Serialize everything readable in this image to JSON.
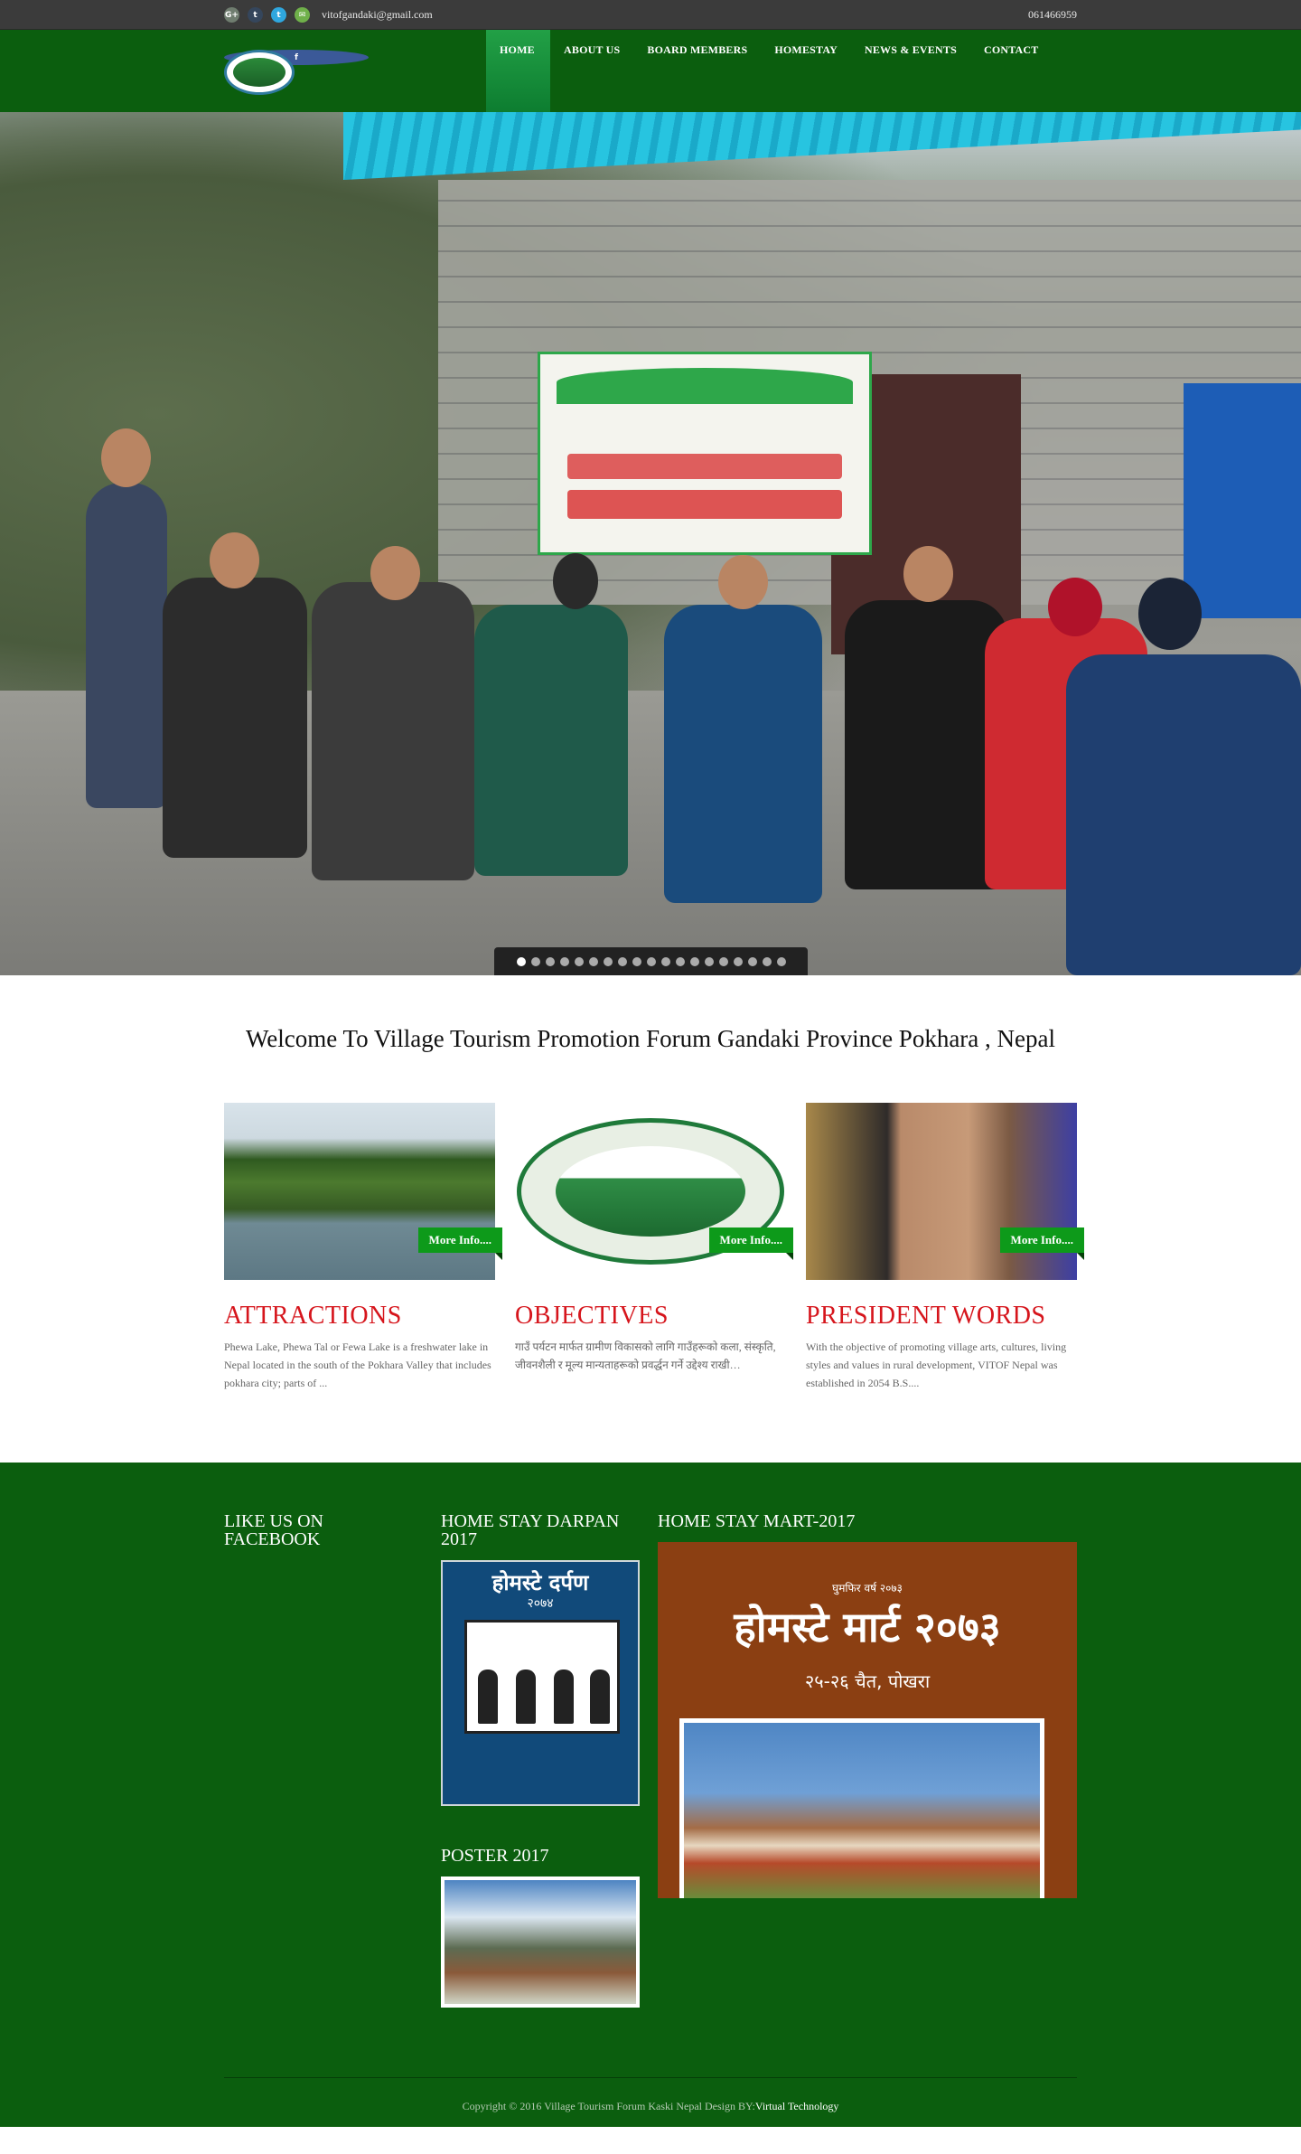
{
  "topbar": {
    "social": [
      {
        "icon": "google-plus-icon",
        "glyph": "G+"
      },
      {
        "icon": "facebook-icon",
        "glyph": "f"
      },
      {
        "icon": "tumblr-icon",
        "glyph": "t"
      },
      {
        "icon": "twitter-icon",
        "glyph": "t"
      },
      {
        "icon": "email-icon",
        "glyph": "✉"
      }
    ],
    "email": "vitofgandaki@gmail.com",
    "phone": "061466959"
  },
  "nav": {
    "items": [
      "HOME",
      "ABOUT US",
      "BOARD MEMBERS",
      "HOMESTAY",
      "NEWS & EVENTS",
      "CONTACT"
    ],
    "active": "HOME"
  },
  "hero": {
    "slide_count": 19,
    "active_slide": 1
  },
  "welcome": {
    "title": "Welcome To Village Tourism Promotion Forum Gandaki Province Pokhara , Nepal"
  },
  "features": [
    {
      "title": "ATTRACTIONS",
      "text": "Phewa Lake, Phewa Tal or Fewa Lake is a freshwater lake in Nepal located in the south of the Pokhara Valley that includes pokhara city; parts of ...",
      "more": "More Info...."
    },
    {
      "title": "OBJECTIVES",
      "text": "गाउँ पर्यटन मार्फत ग्रामीण विकासको लागि गाउँहरूको कला, संस्कृति, जीवनशैली र मूल्य मान्यताहरूको प्रवर्द्धन गर्ने उद्देश्य राखी…",
      "more": "More Info...."
    },
    {
      "title": "PRESIDENT WORDS",
      "text": "With the objective of promoting village arts, cultures, living styles and values in rural development, VITOF Nepal was established in 2054 B.S....",
      "more": "More Info...."
    }
  ],
  "footer": {
    "facebook_title": "LIKE US ON FACEBOOK",
    "darpan_title": "HOME STAY DARPAN 2017",
    "darpan_cover_title": "होमस्टे दर्पण",
    "darpan_cover_year": "२०७४",
    "mart_title": "HOME STAY MART-2017",
    "mart_small": "घुमफिर वर्ष २०७३",
    "mart_heading": "होमस्टे मार्ट २०७३",
    "mart_date": "२५-२६ चैत, पोखरा",
    "poster_title": "POSTER 2017",
    "copyright": "Copyright © 2016 Village Tourism Forum Kaski Nepal Design BY:",
    "designer": "Virtual Technology"
  },
  "colors": {
    "topbar": "#3b3b3b",
    "header_green": "#0b5e0e",
    "active_nav": "#22a046",
    "accent_red": "#d6151c",
    "button_green": "#0d9a1a"
  }
}
